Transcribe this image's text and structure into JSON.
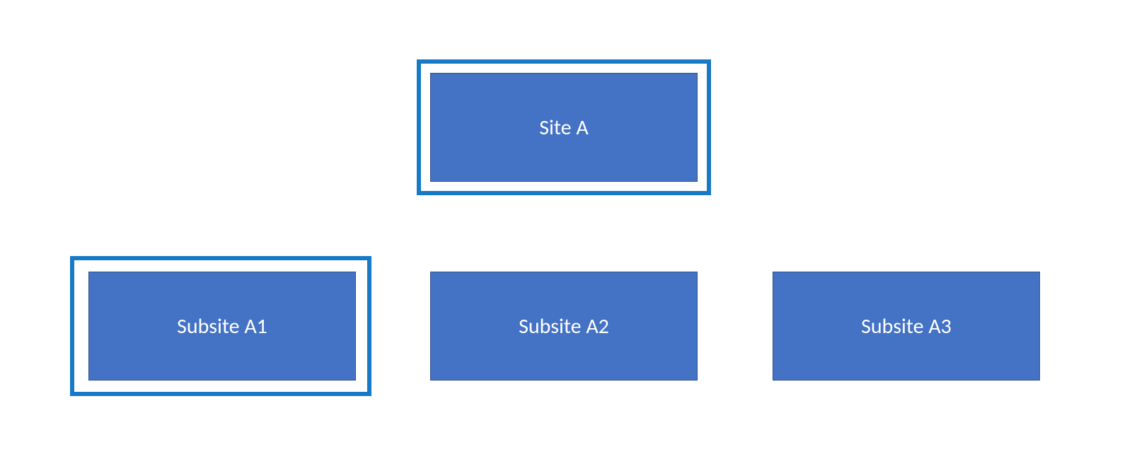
{
  "diagram": {
    "root": {
      "label": "Site A",
      "highlighted": true
    },
    "children": [
      {
        "label": "Subsite A1",
        "highlighted": true
      },
      {
        "label": "Subsite A2",
        "highlighted": false
      },
      {
        "label": "Subsite A3",
        "highlighted": false
      }
    ],
    "colors": {
      "node_fill": "#4472C4",
      "node_border": "#2F528F",
      "highlight_border": "#167AC6",
      "text": "#FFFFFF"
    }
  }
}
